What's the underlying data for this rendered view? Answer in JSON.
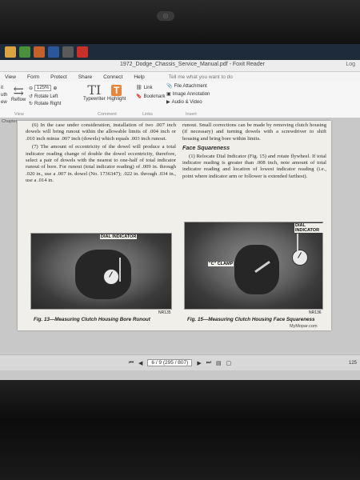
{
  "taskbar": {
    "icons": [
      {
        "name": "file-explorer-icon",
        "color": "#d9a441"
      },
      {
        "name": "chrome-icon",
        "color": "#4a8f3c"
      },
      {
        "name": "firefox-icon",
        "color": "#c5602a"
      },
      {
        "name": "word-icon",
        "color": "#2b579a"
      },
      {
        "name": "settings-icon",
        "color": "#5a5a5a"
      },
      {
        "name": "foxit-icon",
        "color": "#c8302a"
      }
    ]
  },
  "titlebar": {
    "title": "1972_Dodge_Chassis_Service_Manual.pdf - Foxit Reader",
    "user": "Log"
  },
  "menu": {
    "items": [
      "View",
      "Form",
      "Protect",
      "Share",
      "Connect",
      "Help"
    ],
    "tellme": "Tell me what you want to do"
  },
  "ribbon": {
    "rotate_left": "Rotate Left",
    "rotate_right": "Rotate Right",
    "reflow": "Reflow",
    "zoom_value": "125%",
    "view_group": "View",
    "typewriter": "Typewriter",
    "highlight": "Highlight",
    "comment_group": "Comment",
    "link": "Link",
    "bookmark": "Bookmark",
    "links_group": "Links",
    "file_attachment": "File Attachment",
    "image_annotation": "Image Annotation",
    "audio_video": "Audio & Video",
    "insert_group": "Insert",
    "side_labels": [
      "it",
      "uth",
      "ew"
    ]
  },
  "document": {
    "chapter_tab": "Chapter",
    "left_col": {
      "p6": "(6) In the case under consideration, installation of two .007 inch dowels will bring runout within the allowable limits of .004 inch or .010 inch minus .007 inch (dowels) which equals .003 inch runout.",
      "p7": "(7) The amount of eccentricity of the dowel will produce a total indicator reading change of double the dowel eccentricity, therefore, select a pair of dowels with the nearest to one-half of total indicator runout of bore. For runout (total indicator reading) of .009 in. through .020 in., use a .007 in. dowel (No. 1736347); .022 in. through .034 in., use a .014 in."
    },
    "right_col": {
      "p_top": "runout. Small corrections can be made by removing clutch housing (if necessary) and turning dowels with a screwdriver to shift housing and bring bore within limits.",
      "heading": "Face Squareness",
      "p1": "(1) Relocate Dial Indicator (Fig. 15) and rotate flywheel. If total indicator reading is greater than .008 inch, note amount of total indicator reading and location of lowest indicator reading (i.e., point where indicator arm or follower is extended farthest)."
    },
    "fig13": {
      "label": "DIAL INDICATOR",
      "code": "NR135",
      "caption": "Fig. 13—Measuring Clutch Housing Bore Runout"
    },
    "fig15": {
      "label_dial": "DIAL INDICATOR",
      "label_clamp": "\"C\" CLAMP",
      "code": "NR136",
      "caption": "Fig. 15—Measuring Clutch Housing Face Squareness",
      "watermark": "MyMopar.com"
    }
  },
  "navigation": {
    "page_display": "6 / 9 (295 / 807)",
    "right_hint": "125"
  }
}
